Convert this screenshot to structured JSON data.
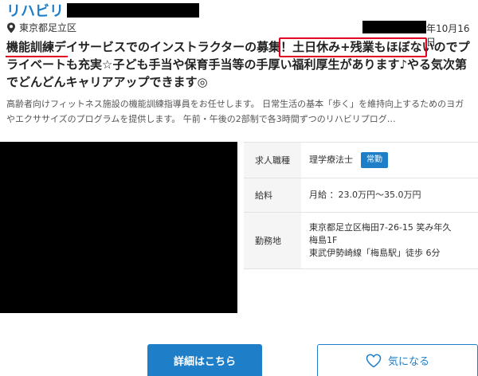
{
  "header": {
    "brand": "リハビリ",
    "location": "東京都足立区",
    "date_suffix": "年10月16日"
  },
  "job": {
    "title": "機能訓練デイサービスでのインストラクターの募集！土日休み+残業もほぼないのでプライベートも充実☆子ども手当や保育手当等の手厚い福利厚生があります♪やる気次第でどんどんキャリアアップできます◎",
    "highlight": "土日休み+残業もほぼないの",
    "description": "高齢者向けフィットネス施設の機能訓練指導員をお任せします。 日常生活の基本「歩く」を維持向上するためのヨガやエクササイズのプログラムを提供します。 午前・午後の2部制で各3時間ずつのリハビリプログ…"
  },
  "details": {
    "occupation_label": "求人職種",
    "occupation_value": "理学療法士",
    "employment_badge": "常勤",
    "salary_label": "給料",
    "salary_value": "月給 ：23.0万円〜35.0万円",
    "workplace_label": "勤務地",
    "workplace_line1": "東京都足立区梅田7-26-15 笑み年久",
    "workplace_line2": "梅島1F",
    "workplace_line3": "東武伊勢崎線「梅島駅」徒歩 6分"
  },
  "actions": {
    "detail_label": "詳細はこちら",
    "favorite_label": "気になる"
  },
  "colors": {
    "accent": "#1e7fc8",
    "highlight_red": "#e1001f"
  }
}
